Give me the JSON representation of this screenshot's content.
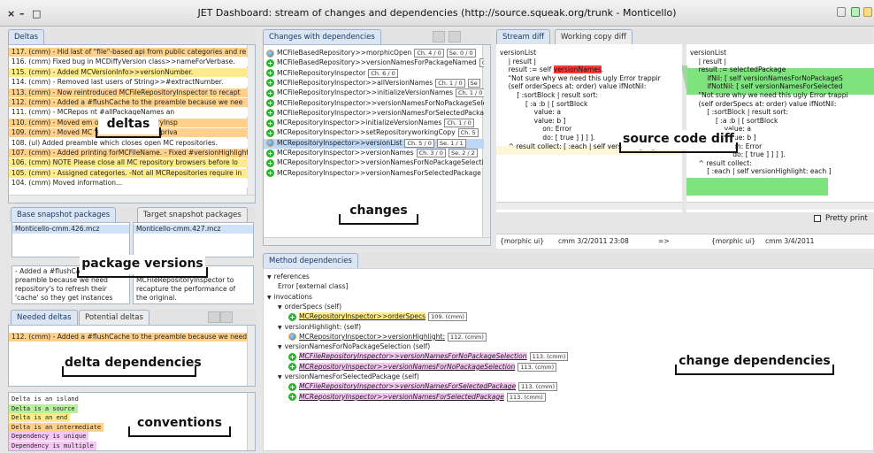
{
  "window": {
    "title": "JET Dashboard: stream of changes and dependencies (http://source.squeak.org/trunk - Monticello)",
    "controls": [
      "×",
      "–",
      "□"
    ]
  },
  "deltas": {
    "tab": "Deltas",
    "rows": [
      "117. (cmm) - Hid last of \"file\"-based api from public categories and re",
      "116. (cmm) Fixed bug in MCDiffyVersion class>>nameForVerbase.",
      "115. (cmm) - Added MCVersionInfo>>versionNumber.",
      "114. (cmm) - Removed last users of String>>#extractNumber.",
      "113. (cmm) - Now reintroduced MCFileRepositoryInspector to recapt",
      "112. (cmm) - Added a #flushCache to the preamble because we nee",
      "111. (cmm) - MCRepos          nt #allPackageNames an",
      "110. (cmm) - Moved em          ods to MCRepositoryInsp",
      "109. (cmm) - Moved MC           's file-based API to 'priva",
      "108. (ul) Added preamble which closes open MC repositories.",
      "107. (cmm) - Added printing forMCFileName. - Fixed #versionHighlight",
      "106. (cmm) NOTE Please close all MC repository browsers before lo",
      "105. (cmm) - Assigned categories. -Not all MCRepositories require in",
      "104. (cmm) Moved information..."
    ],
    "callout": "deltas"
  },
  "packages": {
    "base_tab": "Base snapshot packages",
    "target_tab": "Target snapshot packages",
    "base_value": "Monticello-cmm.426.mcz",
    "target_value": "Monticello-cmm.427.mcz",
    "base_desc": [
      "- Added a #flushCa",
      "preamble because we need",
      "repository's to refresh their",
      "'cache' so they get instances"
    ],
    "target_desc": [
      "MCFileRepositoryInspector to",
      "recapture the performance of",
      "the original."
    ],
    "callout": "package versions"
  },
  "needed": {
    "tabs": [
      "Needed deltas",
      "Potential deltas"
    ],
    "row": "112. (cmm) - Added a #flushCache to the preamble because we need",
    "callout": "delta dependencies"
  },
  "conventions": {
    "items": [
      "Delta is an island",
      "Delta is a source",
      "Delta is an end",
      "Delta is an intermediate",
      "Dependency is unique",
      "Dependency is multiple"
    ],
    "colors": [
      "#ffffff",
      "#b8f0a0",
      "#ffeb88",
      "#ffd08a",
      "#f6c7f2",
      "#f6c7f2"
    ],
    "callout": "conventions"
  },
  "changes": {
    "tab": "Changes with dependencies",
    "rows": [
      {
        "icon": "modified-icon",
        "text": "MCFileBasedRepository>>morphicOpen",
        "badge": "Ch. 4 / 0",
        "extra": "Se. 0 / 0"
      },
      {
        "icon": "added-icon",
        "text": "MCFileBasedRepository>>versionNamesForPackageNamed",
        "badge": "Ch",
        "extra": ""
      },
      {
        "icon": "added-icon",
        "text": "MCFileRepositoryInspector",
        "badge": "Ch. 6 / 0",
        "extra": ""
      },
      {
        "icon": "added-icon",
        "text": "MCFileRepositoryInspector>>allVersionNames",
        "badge": "Ch. 1 / 0",
        "extra": "Se"
      },
      {
        "icon": "added-icon",
        "text": "MCFileRepositoryInspector>>initializeVersionNames",
        "badge": "Ch. 1 / 0",
        "extra": ""
      },
      {
        "icon": "added-icon",
        "text": "MCFileRepositoryInspector>>versionNamesForNoPackageSele",
        "badge": "",
        "extra": ""
      },
      {
        "icon": "added-icon",
        "text": "MCFileRepositoryInspector>>versionNamesForSelectedPacka",
        "badge": "",
        "extra": ""
      },
      {
        "icon": "added-icon",
        "text": "MCRepositoryInspector>>initializeVersionNames",
        "badge": "Ch. 1 / 0",
        "extra": ""
      },
      {
        "icon": "added-icon",
        "text": "MCRepositoryInspector>>setRepositoryworkingCopy",
        "badge": "Ch. 5",
        "extra": ""
      },
      {
        "icon": "modified-icon",
        "text": "MCRepositoryInspector>>versionList",
        "badge": "Ch. 5 / 0",
        "extra": "Se. 1 / 1"
      },
      {
        "icon": "added-icon",
        "text": "MCRepositoryInspector>>versionNames",
        "badge": "Ch. 3 / 0",
        "extra": "Se. 2 / 2"
      },
      {
        "icon": "added-icon",
        "text": "MCRepositoryInspector>>versionNamesForNoPackageSelecti",
        "badge": "",
        "extra": ""
      },
      {
        "icon": "added-icon",
        "text": "MCRepositoryInspector>>versionNamesForSelectedPackage",
        "badge": "",
        "extra": ""
      }
    ],
    "callout": "changes"
  },
  "diff": {
    "tabs": [
      "Stream diff",
      "Working copy diff"
    ],
    "left": [
      "versionList",
      "    | result |",
      "    result := self versionNames.",
      "    \"Not sure why we need this ugly Error trappir",
      "    (self orderSpecs at: order) value ifNotNil:",
      "        [ :sortBlock | result sort:",
      "            [ :a :b | [ sortBlock",
      "                value: a",
      "                value: b ]",
      "                    on: Error",
      "                    do: [ true ] ] ] ].",
      "    ^ result collect: [ :each | self versionHighlight"
    ],
    "right": [
      "versionList",
      "    | result |",
      "    result := selectedPackage",
      "        ifNil: [ self versionNamesForNoPackageS",
      "        ifNotNil: [ self versionNamesForSelected",
      "    \"Not sure why we need this ugly Error trappi",
      "    (self orderSpecs at: order) value ifNotNil:",
      "        [ :sortBlock | result sort:",
      "            [ :a :b | [ sortBlock",
      "                value: a",
      "                value: b ]",
      "                    on: Error",
      "                    do: [ true ] ] ] ].",
      "    ^ result collect:",
      "        [ :each | self versionHighlight: each ]"
    ],
    "pretty_print": "Pretty print",
    "footer_left_pkg": "{morphic ui}",
    "footer_left_ver": "cmm 3/2/2011 23:08",
    "footer_arrow": "=>",
    "footer_right_pkg": "{morphic ui}",
    "footer_right_ver": "cmm 3/4/2011",
    "callout": "source code diff"
  },
  "method_deps": {
    "tab": "Method dependencies",
    "tree": [
      {
        "level": 0,
        "text": "references",
        "arrow": "▼"
      },
      {
        "level": 1,
        "text": "Error [external class]"
      },
      {
        "level": 0,
        "text": "invocations",
        "arrow": "▼"
      },
      {
        "level": 1,
        "text": "orderSpecs (self)",
        "arrow": "▼"
      },
      {
        "level": 2,
        "icon": "added-icon",
        "text": "MCRepositoryInspector>>orderSpecs",
        "badge": "109. (cmm)",
        "style": "yellow"
      },
      {
        "level": 1,
        "text": "versionHighlight: (self)",
        "arrow": "▼"
      },
      {
        "level": 2,
        "icon": "modified-icon",
        "text": "MCRepositoryInspector>>versionHighlight:",
        "badge": "112. (cmm)",
        "style": ""
      },
      {
        "level": 1,
        "text": "versionNamesForNoPackageSelection (self)",
        "arrow": "▼"
      },
      {
        "level": 2,
        "icon": "added-icon",
        "text": "MCFileRepositoryInspector>>versionNamesForNoPackageSelection",
        "badge": "113. (cmm)",
        "style": "pink"
      },
      {
        "level": 2,
        "icon": "added-icon",
        "text": "MCRepositoryInspector>>versionNamesForNoPackageSelection",
        "badge": "113. (cmm)",
        "style": "pink"
      },
      {
        "level": 1,
        "text": "versionNamesForSelectedPackage (self)",
        "arrow": "▼"
      },
      {
        "level": 2,
        "icon": "added-icon",
        "text": "MCFileRepositoryInspector>>versionNamesForSelectedPackage",
        "badge": "113. (cmm)",
        "style": "pink"
      },
      {
        "level": 2,
        "icon": "added-icon",
        "text": "MCRepositoryInspector>>versionNamesForSelectedPackage",
        "badge": "113. (cmm)",
        "style": "pink"
      }
    ],
    "callout": "change dependencies"
  }
}
